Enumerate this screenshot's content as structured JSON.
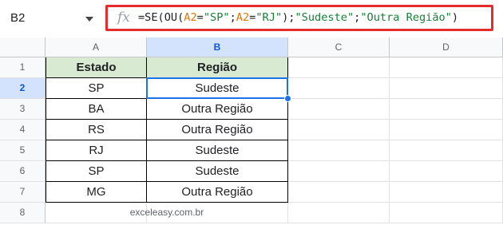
{
  "formula_bar": {
    "name_box": "B2",
    "fx_icon": "fx",
    "formula_parts": [
      {
        "text": "=SE(OU(",
        "kind": "plain"
      },
      {
        "text": "A2",
        "kind": "ref"
      },
      {
        "text": "=",
        "kind": "plain"
      },
      {
        "text": "\"SP\"",
        "kind": "str"
      },
      {
        "text": ";",
        "kind": "plain"
      },
      {
        "text": "A2",
        "kind": "ref"
      },
      {
        "text": "=",
        "kind": "plain"
      },
      {
        "text": "\"RJ\"",
        "kind": "str"
      },
      {
        "text": ");",
        "kind": "plain"
      },
      {
        "text": "\"Sudeste\"",
        "kind": "str"
      },
      {
        "text": ";",
        "kind": "plain"
      },
      {
        "text": "\"Outra Região\"",
        "kind": "str"
      },
      {
        "text": ")",
        "kind": "plain"
      }
    ]
  },
  "grid": {
    "columns": [
      "A",
      "B",
      "C",
      "D"
    ],
    "rows": [
      "1",
      "2",
      "3",
      "4",
      "5",
      "6",
      "7",
      "8"
    ],
    "selected_cell": "B2",
    "table_header": [
      "Estado",
      "Região"
    ],
    "table_rows": [
      [
        "SP",
        "Sudeste"
      ],
      [
        "BA",
        "Outra Região"
      ],
      [
        "RS",
        "Outra Região"
      ],
      [
        "RJ",
        "Sudeste"
      ],
      [
        "SP",
        "Sudeste"
      ],
      [
        "MG",
        "Outra Região"
      ]
    ],
    "watermark": "exceleasy.com.br"
  },
  "colors": {
    "header_fill": "#d9ead3",
    "selection": "#1a73e8",
    "formula_highlight_border": "#e52b2b",
    "ref_color": "#e37400",
    "string_color": "#188038"
  }
}
